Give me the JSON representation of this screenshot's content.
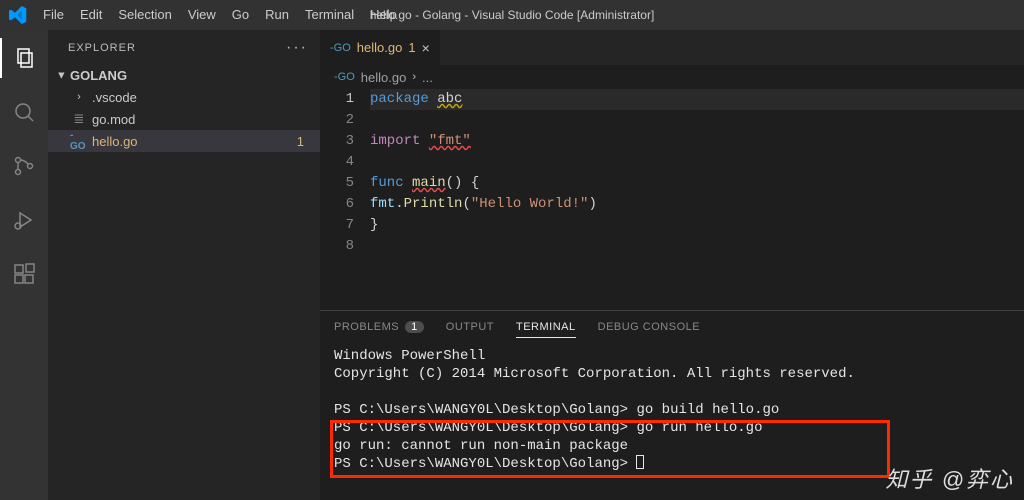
{
  "titlebar": {
    "menus": [
      "File",
      "Edit",
      "Selection",
      "View",
      "Go",
      "Run",
      "Terminal",
      "Help"
    ],
    "title": "hello.go - Golang - Visual Studio Code [Administrator]"
  },
  "sidebar": {
    "title": "EXPLORER",
    "root": "GOLANG",
    "items": [
      {
        "label": ".vscode",
        "icon": "chevron"
      },
      {
        "label": "go.mod",
        "icon": "lines"
      },
      {
        "label": "hello.go",
        "icon": "go",
        "selected": true,
        "badge": "1"
      }
    ]
  },
  "tab": {
    "label": "hello.go",
    "modified_badge": "1"
  },
  "breadcrumb": {
    "file": "hello.go",
    "tail": "..."
  },
  "lines": [
    "1",
    "2",
    "3",
    "4",
    "5",
    "6",
    "7",
    "8"
  ],
  "code": {
    "l1_kw": "package",
    "l1_id": "abc",
    "l3_kw": "import",
    "l3_str": "\"fmt\"",
    "l5_kw": "func",
    "l5_fn": "main",
    "l5_tail": "() {",
    "l6_indent": "    ",
    "l6_obj": "fmt",
    "l6_dot": ".",
    "l6_fn": "Println",
    "l6_paren": "(",
    "l6_str": "\"Hello World!\"",
    "l6_close": ")",
    "l7": "}"
  },
  "panel": {
    "tabs": {
      "problems": "PROBLEMS",
      "problems_count": "1",
      "output": "OUTPUT",
      "terminal": "TERMINAL",
      "debug": "DEBUG CONSOLE"
    }
  },
  "terminal": {
    "line1": "Windows PowerShell",
    "line2": "Copyright (C) 2014 Microsoft Corporation. All rights reserved.",
    "blank": "",
    "p1_prompt": "PS C:\\Users\\WANGY0L\\Desktop\\Golang>",
    "p1_cmd": "go build hello.go",
    "p2_prompt": "PS C:\\Users\\WANGY0L\\Desktop\\Golang>",
    "p2_cmd": "go run hello.go",
    "err": "go run: cannot run non-main package",
    "p3_prompt": "PS C:\\Users\\WANGY0L\\Desktop\\Golang>"
  },
  "watermark": "知乎 @弈心"
}
